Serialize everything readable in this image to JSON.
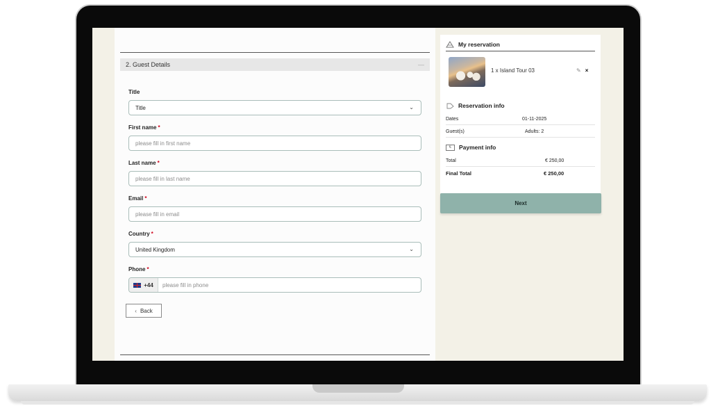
{
  "guest_details": {
    "section_title": "2.  Guest Details",
    "collapse_symbol": "—",
    "fields": {
      "title": {
        "label": "Title",
        "value": "Title"
      },
      "first_name": {
        "label": "First name",
        "required_mark": "*",
        "placeholder": "please fill in first name"
      },
      "last_name": {
        "label": "Last name",
        "required_mark": "*",
        "placeholder": "please fill in last name"
      },
      "email": {
        "label": "Email",
        "required_mark": "*",
        "placeholder": "please fill in email"
      },
      "country": {
        "label": "Country",
        "required_mark": "*",
        "value": "United Kingdom"
      },
      "phone": {
        "label": "Phone",
        "required_mark": "*",
        "prefix": "+44",
        "placeholder": "please fill in phone"
      }
    },
    "back_label": "Back",
    "back_arrow": "‹",
    "chevron": "⌄"
  },
  "reservation": {
    "title": "My reservation",
    "item": {
      "text": "1 x  Island Tour 03",
      "edit_icon": "edit-icon",
      "remove_symbol": "×",
      "edit_symbol": "✎"
    },
    "info_title": "Reservation info",
    "rows": [
      {
        "key": "Dates",
        "value": "01-11-2025"
      },
      {
        "key": "Guest(s)",
        "value": "Adults: 2"
      }
    ],
    "payment_title": "Payment info",
    "payment_icon_symbol": "€",
    "payment_rows": [
      {
        "key": "Total",
        "value": "€  250,00"
      },
      {
        "key": "Final Total",
        "value": "€  250,00"
      }
    ]
  },
  "next_label": "Next",
  "colors": {
    "accent": "#8fb2aa",
    "field_border": "#a9bdb9",
    "required": "#d0021b",
    "background": "#f3f1e7"
  }
}
